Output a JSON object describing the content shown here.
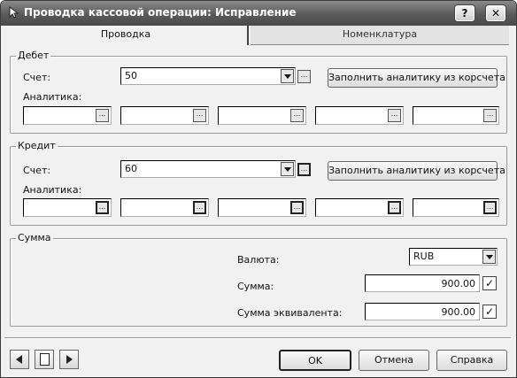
{
  "window": {
    "title": "Проводка кассовой операции: Исправление",
    "help_label": "?",
    "close_label": "✕"
  },
  "tabs": [
    {
      "label": "Проводка",
      "active": true
    },
    {
      "label": "Номенклатура",
      "active": false
    }
  ],
  "debit": {
    "legend": "Дебет",
    "account_label": "Счет:",
    "account_value": "50",
    "fill_button": "Заполнить аналитику из корсчета",
    "analytics_label": "Аналитика:",
    "analytics": [
      "",
      "",
      "",
      "",
      ""
    ]
  },
  "credit": {
    "legend": "Кредит",
    "account_label": "Счет:",
    "account_value": "60",
    "fill_button": "Заполнить аналитику из корсчета",
    "analytics_label": "Аналитика:",
    "analytics": [
      "",
      "",
      "",
      "",
      ""
    ]
  },
  "sum": {
    "legend": "Сумма",
    "currency_label": "Валюта:",
    "currency_value": "RUB",
    "amount_label": "Сумма:",
    "amount_value": "900.00",
    "amount_checked": true,
    "equiv_label": "Сумма эквивалента:",
    "equiv_value": "900.00",
    "equiv_checked": true
  },
  "footer": {
    "ok": "OK",
    "cancel": "Отмена",
    "help": "Справка"
  },
  "icons": {
    "check": "✓",
    "ellipsis": "..."
  }
}
